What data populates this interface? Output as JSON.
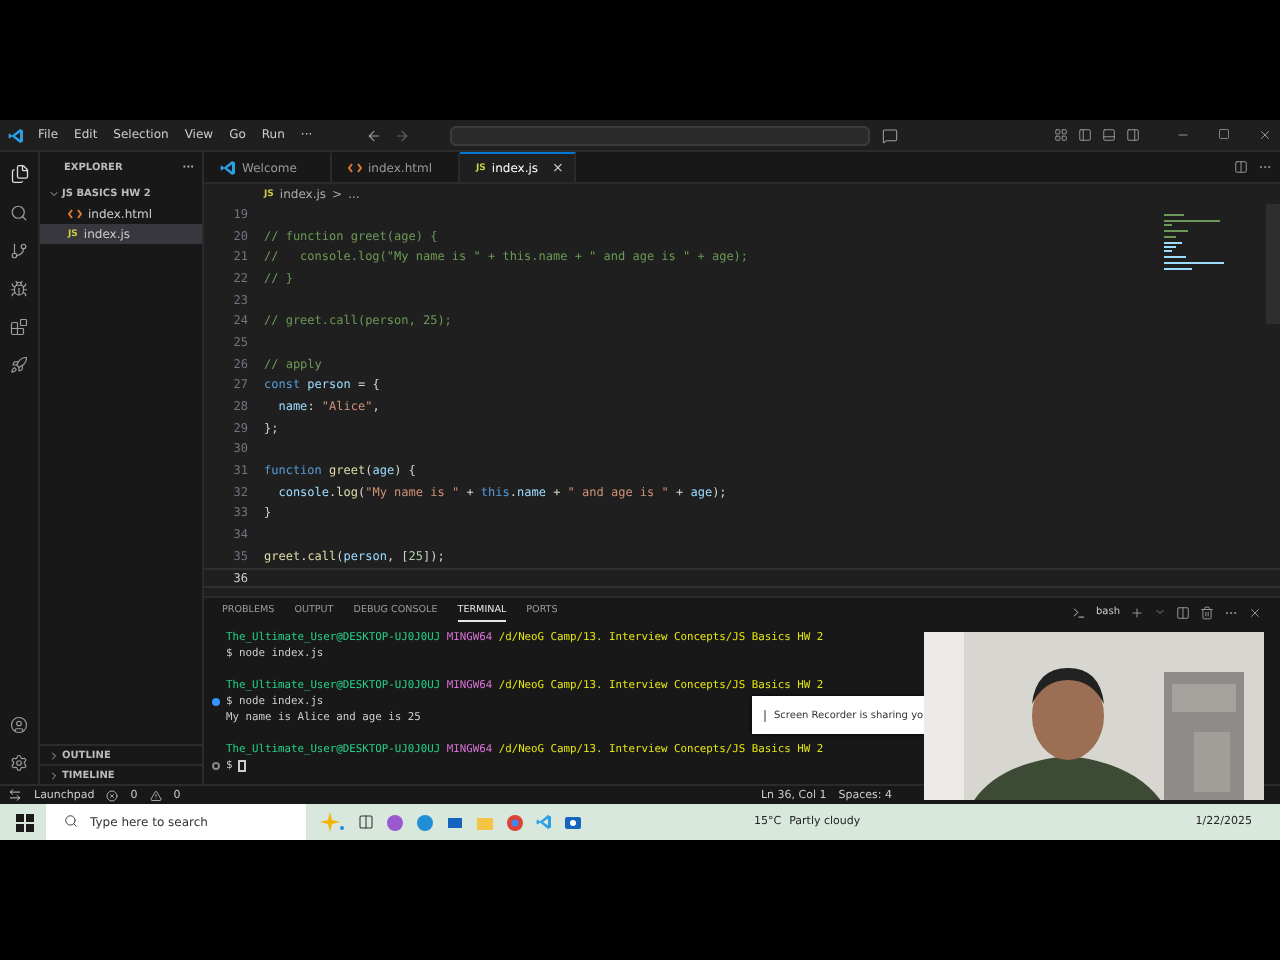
{
  "menu": [
    "File",
    "Edit",
    "Selection",
    "View",
    "Go",
    "Run",
    "···"
  ],
  "explorer": {
    "title": "EXPLORER",
    "more": "···",
    "folder": "JS BASICS HW 2",
    "files": [
      {
        "name": "index.html",
        "kind": "html",
        "selected": false
      },
      {
        "name": "index.js",
        "kind": "js",
        "badge": "JS",
        "selected": true
      }
    ],
    "sections": [
      "OUTLINE",
      "TIMELINE"
    ]
  },
  "tabs": [
    {
      "label": "Welcome",
      "kind": "vscode",
      "selected": false
    },
    {
      "label": "index.html",
      "kind": "html",
      "selected": false
    },
    {
      "label": "index.js",
      "kind": "js",
      "badge": "JS",
      "selected": true,
      "close": "×"
    }
  ],
  "breadcrumb": {
    "badge": "JS",
    "file": "index.js",
    "separator": ">",
    "rest": "..."
  },
  "code": [
    {
      "n": "19",
      "current": false
    },
    {
      "n": "20",
      "current": false,
      "tokens": [
        {
          "kind": "comment",
          "text": "// function greet(age) {"
        }
      ]
    },
    {
      "n": "21",
      "current": false,
      "tokens": [
        {
          "kind": "comment",
          "text": "//   console.log(\"My name is \" + this.name + \" and age is \" + age);"
        }
      ]
    },
    {
      "n": "22",
      "current": false,
      "tokens": [
        {
          "kind": "comment",
          "text": "// }"
        }
      ]
    },
    {
      "n": "23",
      "current": false
    },
    {
      "n": "24",
      "current": false,
      "tokens": [
        {
          "kind": "comment",
          "text": "// greet.call(person, 25);"
        }
      ]
    },
    {
      "n": "25",
      "current": false
    },
    {
      "n": "26",
      "current": false,
      "tokens": [
        {
          "kind": "comment",
          "text": "// apply"
        }
      ]
    },
    {
      "n": "27",
      "current": false,
      "tokens": [
        {
          "kind": "keyword",
          "text": "const"
        },
        {
          "kind": "var",
          "text": " person"
        },
        {
          "kind": "plain",
          "text": " = {"
        }
      ]
    },
    {
      "n": "28",
      "current": false,
      "tokens": [
        {
          "kind": "var",
          "text": "  name"
        },
        {
          "kind": "plain",
          "text": ": "
        },
        {
          "kind": "string",
          "text": "\"Alice\""
        },
        {
          "kind": "plain",
          "text": ","
        }
      ]
    },
    {
      "n": "29",
      "current": false,
      "tokens": [
        {
          "kind": "plain",
          "text": "};"
        }
      ]
    },
    {
      "n": "30",
      "current": false
    },
    {
      "n": "31",
      "current": false,
      "tokens": [
        {
          "kind": "keyword",
          "text": "function"
        },
        {
          "kind": "func",
          "text": " greet"
        },
        {
          "kind": "plain",
          "text": "("
        },
        {
          "kind": "var",
          "text": "age"
        },
        {
          "kind": "plain",
          "text": ") {"
        }
      ]
    },
    {
      "n": "32",
      "current": false,
      "tokens": [
        {
          "kind": "var",
          "text": "  console"
        },
        {
          "kind": "plain",
          "text": "."
        },
        {
          "kind": "func",
          "text": "log"
        },
        {
          "kind": "plain",
          "text": "("
        },
        {
          "kind": "string",
          "text": "\"My name is \""
        },
        {
          "kind": "plain",
          "text": " + "
        },
        {
          "kind": "keyword",
          "text": "this"
        },
        {
          "kind": "plain",
          "text": "."
        },
        {
          "kind": "var",
          "text": "name"
        },
        {
          "kind": "plain",
          "text": " + "
        },
        {
          "kind": "string",
          "text": "\" and age is \""
        },
        {
          "kind": "plain",
          "text": " + "
        },
        {
          "kind": "var",
          "text": "age"
        },
        {
          "kind": "plain",
          "text": ");"
        }
      ]
    },
    {
      "n": "33",
      "current": false,
      "tokens": [
        {
          "kind": "plain",
          "text": "}"
        }
      ]
    },
    {
      "n": "34",
      "current": false
    },
    {
      "n": "35",
      "current": false,
      "tokens": [
        {
          "kind": "func",
          "text": "greet"
        },
        {
          "kind": "plain",
          "text": "."
        },
        {
          "kind": "func",
          "text": "call"
        },
        {
          "kind": "plain",
          "text": "("
        },
        {
          "kind": "var",
          "text": "person"
        },
        {
          "kind": "plain",
          "text": ", ["
        },
        {
          "kind": "number",
          "text": "25"
        },
        {
          "kind": "plain",
          "text": "]);"
        }
      ]
    },
    {
      "n": "36",
      "current": true
    }
  ],
  "panel": {
    "tabs": [
      {
        "label": "PROBLEMS",
        "selected": false
      },
      {
        "label": "OUTPUT",
        "selected": false
      },
      {
        "label": "DEBUG CONSOLE",
        "selected": false
      },
      {
        "label": "TERMINAL",
        "selected": true
      },
      {
        "label": "PORTS",
        "selected": false
      }
    ],
    "shell": "bash"
  },
  "terminal": [
    {
      "kind": "prompt",
      "user": "The_Ultimate_User@DESKTOP-UJ0J0UJ",
      "shell": "MINGW64",
      "path": "/d/NeoG Camp/13. Interview Concepts/JS Basics HW 2"
    },
    {
      "kind": "command",
      "text": "$ node index.js",
      "success": false,
      "pending": false
    },
    {
      "kind": "blank"
    },
    {
      "kind": "prompt",
      "user": "The_Ultimate_User@DESKTOP-UJ0J0UJ",
      "shell": "MINGW64",
      "path": "/d/NeoG Camp/13. Interview Concepts/JS Basics HW 2"
    },
    {
      "kind": "command",
      "text": "$ node index.js",
      "success": true,
      "pending": false
    },
    {
      "kind": "output",
      "text": "My name is Alice and age is 25"
    },
    {
      "kind": "blank"
    },
    {
      "kind": "prompt",
      "user": "The_Ultimate_User@DESKTOP-UJ0J0UJ",
      "shell": "MINGW64",
      "path": "/d/NeoG Camp/13. Interview Concepts/JS Basics HW 2"
    },
    {
      "kind": "command",
      "text": "$",
      "success": false,
      "pending": true,
      "cursor": true
    }
  ],
  "notification": {
    "text": "Screen Recorder is sharing yo"
  },
  "status_bar": {
    "launchpad": "Launchpad",
    "errors": "0",
    "warnings": "0",
    "position": "Ln 36, Col 1",
    "spaces": "Spaces: 4"
  },
  "taskbar": {
    "search": {
      "placeholder": "Type here to search"
    },
    "temperature": "15°C",
    "weather": "Partly cloudy",
    "date": "1/22/2025"
  },
  "webcam": {
    "kind": "picture"
  }
}
